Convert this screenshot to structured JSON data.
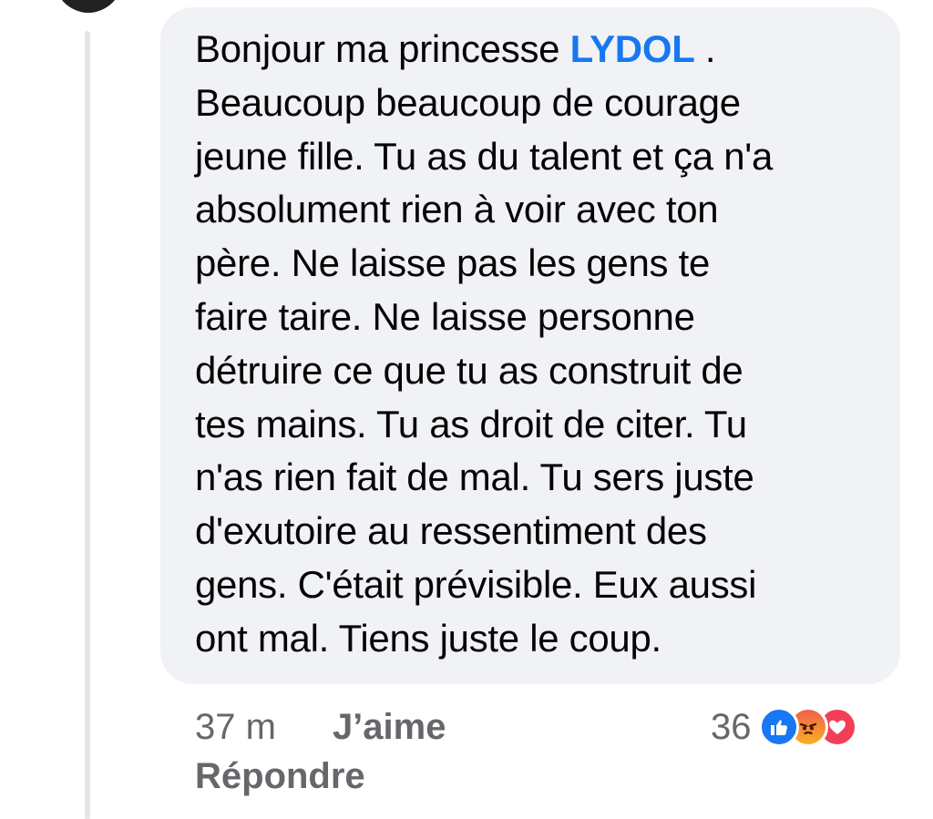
{
  "comment": {
    "text_before_tag": "Bonjour ma princesse ",
    "tag": "LYDOL",
    "text_after_tag": " .\nBeaucoup beaucoup de courage\njeune fille. Tu as du talent et ça n'a\nabsolument rien à voir avec ton\npère. Ne laisse pas les gens te\nfaire taire. Ne laisse personne\ndétruire ce que tu as construit de\ntes mains. Tu as droit de citer. Tu\nn'as rien fait de mal. Tu sers juste\nd'exutoire au ressentiment des\ngens. C'était prévisible. Eux aussi\nont mal. Tiens juste le coup."
  },
  "actions": {
    "time": "37 m",
    "like_label": "J’aime",
    "reply_label": "Répondre"
  },
  "reactions": {
    "count": "36",
    "icons": [
      "like-icon",
      "angry-icon",
      "love-icon"
    ],
    "colors": {
      "like": "#1877f2",
      "angry": "#f06a3c",
      "love": "#f33e58"
    }
  },
  "colors": {
    "bubble_background": "#f0f2f5",
    "mention": "#1877f2",
    "secondary_text": "#65676b"
  }
}
